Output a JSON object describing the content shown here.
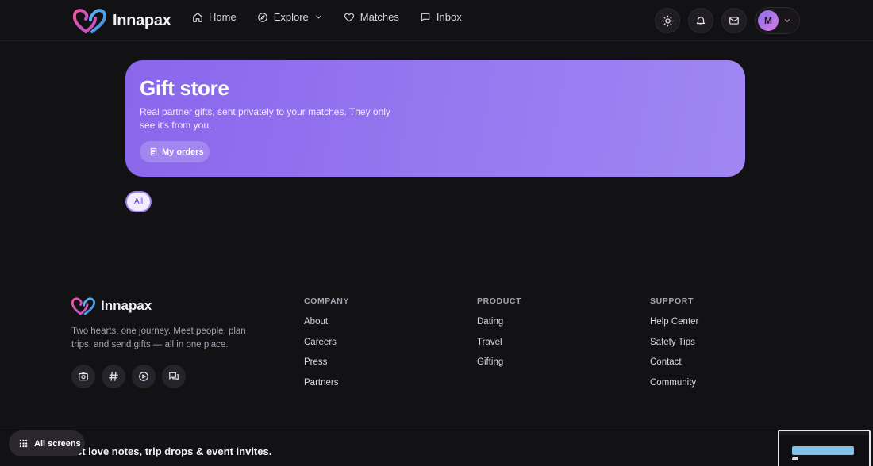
{
  "brand": {
    "name": "Innapax"
  },
  "nav": {
    "items": [
      {
        "label": "Home",
        "icon": "home-icon"
      },
      {
        "label": "Explore",
        "icon": "compass-icon"
      },
      {
        "label": "Matches",
        "icon": "heart-icon"
      },
      {
        "label": "Inbox",
        "icon": "message-icon"
      }
    ]
  },
  "user": {
    "initial": "M"
  },
  "hero": {
    "title": "Gift store",
    "subtitle": "Real partner gifts, sent privately to your matches. They only see it's from you.",
    "orders_label": "My orders"
  },
  "filters": {
    "all_label": "All"
  },
  "footer": {
    "brand": "Innapax",
    "description": "Two hearts, one journey. Meet people, plan trips, and send gifts — all in one place.",
    "columns": [
      {
        "title": "COMPANY",
        "links": [
          "About",
          "Careers",
          "Press",
          "Partners"
        ]
      },
      {
        "title": "PRODUCT",
        "links": [
          "Dating",
          "Travel",
          "Gifting"
        ]
      },
      {
        "title": "SUPPORT",
        "links": [
          "Help Center",
          "Safety Tips",
          "Contact",
          "Community"
        ]
      }
    ],
    "newsletter_text": "et love notes, trip drops & event invites."
  },
  "overlay": {
    "all_screens_label": "All screens"
  },
  "colors": {
    "accent": "#8a66ec",
    "background": "#121114"
  }
}
